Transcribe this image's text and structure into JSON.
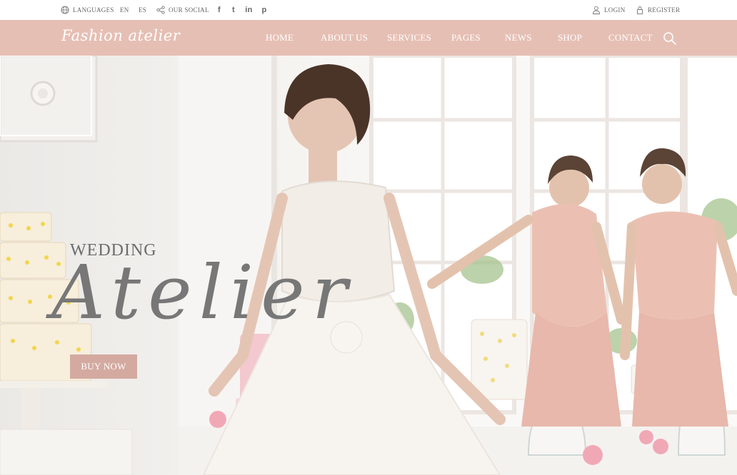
{
  "topbar": {
    "languages_label": "LANGUAGES",
    "lang_en": "EN",
    "lang_es": "ES",
    "social_label": "OUR SOCIAL",
    "social_icons": [
      "facebook-icon",
      "twitter-icon",
      "linkedin-icon",
      "pinterest-icon"
    ],
    "social_glyphs": [
      "f",
      "t",
      "in",
      "p"
    ],
    "login_label": "LOGIN",
    "register_label": "REGISTER"
  },
  "navbar": {
    "logo": "Fashion atelier",
    "items": [
      "HOME",
      "ABOUT US",
      "SERVICES",
      "PAGES",
      "NEWS",
      "SHOP",
      "CONTACT"
    ],
    "search_icon": "search-icon"
  },
  "hero": {
    "kicker": "WEDDING",
    "title": "Atelier",
    "cta": "BUY NOW"
  },
  "colors": {
    "nav_background": "#e6bfb4",
    "cta_background": "#d4aaa0",
    "text_grey": "#6c6c6c"
  }
}
